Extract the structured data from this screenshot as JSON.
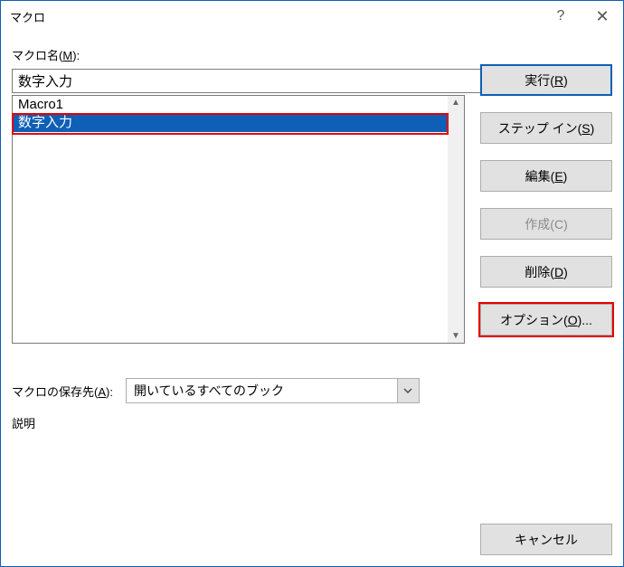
{
  "title": "マクロ",
  "label_macro_name_pre": "マクロ名(",
  "label_macro_name_key": "M",
  "label_macro_name_post": "):",
  "macro_name_value": "数字入力",
  "macro_list": {
    "item0": "Macro1",
    "item1": "数字入力"
  },
  "storage_pre": "マクロの保存先(",
  "storage_key": "A",
  "storage_post": "):",
  "storage_value": "開いているすべてのブック",
  "desc_label": "説明",
  "buttons": {
    "run_pre": "実行(",
    "run_key": "R",
    "run_post": ")",
    "step_pre": "ステップ イン(",
    "step_key": "S",
    "step_post": ")",
    "edit_pre": "編集(",
    "edit_key": "E",
    "edit_post": ")",
    "create_pre": "作成(",
    "create_key": "C",
    "create_post": ")",
    "delete_pre": "削除(",
    "delete_key": "D",
    "delete_post": ")",
    "options_pre": "オプション(",
    "options_key": "O",
    "options_post": ")...",
    "cancel": "キャンセル"
  },
  "help_glyph": "?",
  "close_glyph": "✕"
}
